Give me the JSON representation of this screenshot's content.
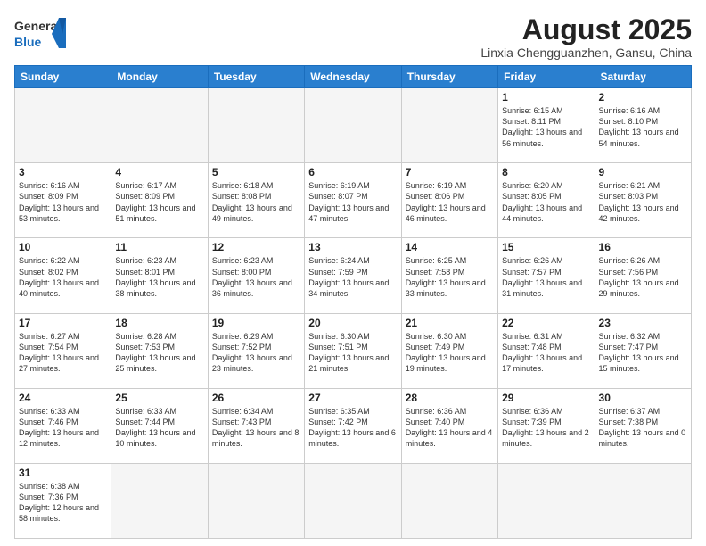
{
  "header": {
    "logo_general": "General",
    "logo_blue": "Blue",
    "title": "August 2025",
    "subtitle": "Linxia Chengguanzhen, Gansu, China"
  },
  "weekdays": [
    "Sunday",
    "Monday",
    "Tuesday",
    "Wednesday",
    "Thursday",
    "Friday",
    "Saturday"
  ],
  "weeks": [
    [
      {
        "day": "",
        "info": ""
      },
      {
        "day": "",
        "info": ""
      },
      {
        "day": "",
        "info": ""
      },
      {
        "day": "",
        "info": ""
      },
      {
        "day": "",
        "info": ""
      },
      {
        "day": "1",
        "info": "Sunrise: 6:15 AM\nSunset: 8:11 PM\nDaylight: 13 hours and 56 minutes."
      },
      {
        "day": "2",
        "info": "Sunrise: 6:16 AM\nSunset: 8:10 PM\nDaylight: 13 hours and 54 minutes."
      }
    ],
    [
      {
        "day": "3",
        "info": "Sunrise: 6:16 AM\nSunset: 8:09 PM\nDaylight: 13 hours and 53 minutes."
      },
      {
        "day": "4",
        "info": "Sunrise: 6:17 AM\nSunset: 8:09 PM\nDaylight: 13 hours and 51 minutes."
      },
      {
        "day": "5",
        "info": "Sunrise: 6:18 AM\nSunset: 8:08 PM\nDaylight: 13 hours and 49 minutes."
      },
      {
        "day": "6",
        "info": "Sunrise: 6:19 AM\nSunset: 8:07 PM\nDaylight: 13 hours and 47 minutes."
      },
      {
        "day": "7",
        "info": "Sunrise: 6:19 AM\nSunset: 8:06 PM\nDaylight: 13 hours and 46 minutes."
      },
      {
        "day": "8",
        "info": "Sunrise: 6:20 AM\nSunset: 8:05 PM\nDaylight: 13 hours and 44 minutes."
      },
      {
        "day": "9",
        "info": "Sunrise: 6:21 AM\nSunset: 8:03 PM\nDaylight: 13 hours and 42 minutes."
      }
    ],
    [
      {
        "day": "10",
        "info": "Sunrise: 6:22 AM\nSunset: 8:02 PM\nDaylight: 13 hours and 40 minutes."
      },
      {
        "day": "11",
        "info": "Sunrise: 6:23 AM\nSunset: 8:01 PM\nDaylight: 13 hours and 38 minutes."
      },
      {
        "day": "12",
        "info": "Sunrise: 6:23 AM\nSunset: 8:00 PM\nDaylight: 13 hours and 36 minutes."
      },
      {
        "day": "13",
        "info": "Sunrise: 6:24 AM\nSunset: 7:59 PM\nDaylight: 13 hours and 34 minutes."
      },
      {
        "day": "14",
        "info": "Sunrise: 6:25 AM\nSunset: 7:58 PM\nDaylight: 13 hours and 33 minutes."
      },
      {
        "day": "15",
        "info": "Sunrise: 6:26 AM\nSunset: 7:57 PM\nDaylight: 13 hours and 31 minutes."
      },
      {
        "day": "16",
        "info": "Sunrise: 6:26 AM\nSunset: 7:56 PM\nDaylight: 13 hours and 29 minutes."
      }
    ],
    [
      {
        "day": "17",
        "info": "Sunrise: 6:27 AM\nSunset: 7:54 PM\nDaylight: 13 hours and 27 minutes."
      },
      {
        "day": "18",
        "info": "Sunrise: 6:28 AM\nSunset: 7:53 PM\nDaylight: 13 hours and 25 minutes."
      },
      {
        "day": "19",
        "info": "Sunrise: 6:29 AM\nSunset: 7:52 PM\nDaylight: 13 hours and 23 minutes."
      },
      {
        "day": "20",
        "info": "Sunrise: 6:30 AM\nSunset: 7:51 PM\nDaylight: 13 hours and 21 minutes."
      },
      {
        "day": "21",
        "info": "Sunrise: 6:30 AM\nSunset: 7:49 PM\nDaylight: 13 hours and 19 minutes."
      },
      {
        "day": "22",
        "info": "Sunrise: 6:31 AM\nSunset: 7:48 PM\nDaylight: 13 hours and 17 minutes."
      },
      {
        "day": "23",
        "info": "Sunrise: 6:32 AM\nSunset: 7:47 PM\nDaylight: 13 hours and 15 minutes."
      }
    ],
    [
      {
        "day": "24",
        "info": "Sunrise: 6:33 AM\nSunset: 7:46 PM\nDaylight: 13 hours and 12 minutes."
      },
      {
        "day": "25",
        "info": "Sunrise: 6:33 AM\nSunset: 7:44 PM\nDaylight: 13 hours and 10 minutes."
      },
      {
        "day": "26",
        "info": "Sunrise: 6:34 AM\nSunset: 7:43 PM\nDaylight: 13 hours and 8 minutes."
      },
      {
        "day": "27",
        "info": "Sunrise: 6:35 AM\nSunset: 7:42 PM\nDaylight: 13 hours and 6 minutes."
      },
      {
        "day": "28",
        "info": "Sunrise: 6:36 AM\nSunset: 7:40 PM\nDaylight: 13 hours and 4 minutes."
      },
      {
        "day": "29",
        "info": "Sunrise: 6:36 AM\nSunset: 7:39 PM\nDaylight: 13 hours and 2 minutes."
      },
      {
        "day": "30",
        "info": "Sunrise: 6:37 AM\nSunset: 7:38 PM\nDaylight: 13 hours and 0 minutes."
      }
    ],
    [
      {
        "day": "31",
        "info": "Sunrise: 6:38 AM\nSunset: 7:36 PM\nDaylight: 12 hours and 58 minutes."
      },
      {
        "day": "",
        "info": ""
      },
      {
        "day": "",
        "info": ""
      },
      {
        "day": "",
        "info": ""
      },
      {
        "day": "",
        "info": ""
      },
      {
        "day": "",
        "info": ""
      },
      {
        "day": "",
        "info": ""
      }
    ]
  ]
}
